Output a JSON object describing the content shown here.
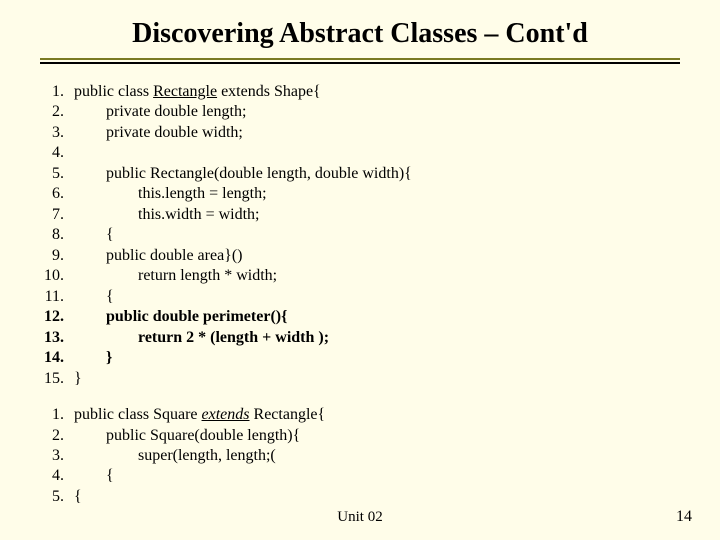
{
  "title": "Discovering Abstract Classes – Cont'd",
  "block1": {
    "lines": [
      {
        "num": "1.",
        "prefix": "public class ",
        "underlined": "Rectangle",
        "suffix": " extends Shape{",
        "bold": false
      },
      {
        "num": "2.",
        "prefix": "        private double length;",
        "bold": false
      },
      {
        "num": "3.",
        "prefix": "        private double width;",
        "bold": false
      },
      {
        "num": "4.",
        "prefix": "",
        "bold": false
      },
      {
        "num": "5.",
        "prefix": "        public Rectangle(double length, double width){",
        "bold": false
      },
      {
        "num": "6.",
        "prefix": "                this.length = length;",
        "bold": false
      },
      {
        "num": "7.",
        "prefix": "                this.width = width;",
        "bold": false
      },
      {
        "num": "8.",
        "prefix": "        {",
        "bold": false
      },
      {
        "num": "9.",
        "prefix": "        public double area}()",
        "bold": false
      },
      {
        "num": "10.",
        "prefix": "                return length * width;",
        "bold": false
      },
      {
        "num": "11.",
        "prefix": "        {",
        "bold": false
      },
      {
        "num": "12.",
        "prefix": "        public double perimeter(){",
        "bold": true
      },
      {
        "num": "13.",
        "prefix": "                return 2 * (length + width );",
        "bold": true
      },
      {
        "num": "14.",
        "prefix": "        }",
        "bold": true
      },
      {
        "num": "15.",
        "prefix": "}",
        "bold": false
      }
    ]
  },
  "block2": {
    "lines": [
      {
        "num": "1.",
        "prefix": "public class Square ",
        "italic_underlined": "extends",
        "suffix": " Rectangle{"
      },
      {
        "num": "2.",
        "prefix": "        public Square(double length){"
      },
      {
        "num": "3.",
        "prefix": "                super(length, length;("
      },
      {
        "num": "4.",
        "prefix": "        {"
      },
      {
        "num": "5.",
        "prefix": "{"
      }
    ]
  },
  "footer": {
    "center": "Unit 02",
    "right": "14"
  }
}
